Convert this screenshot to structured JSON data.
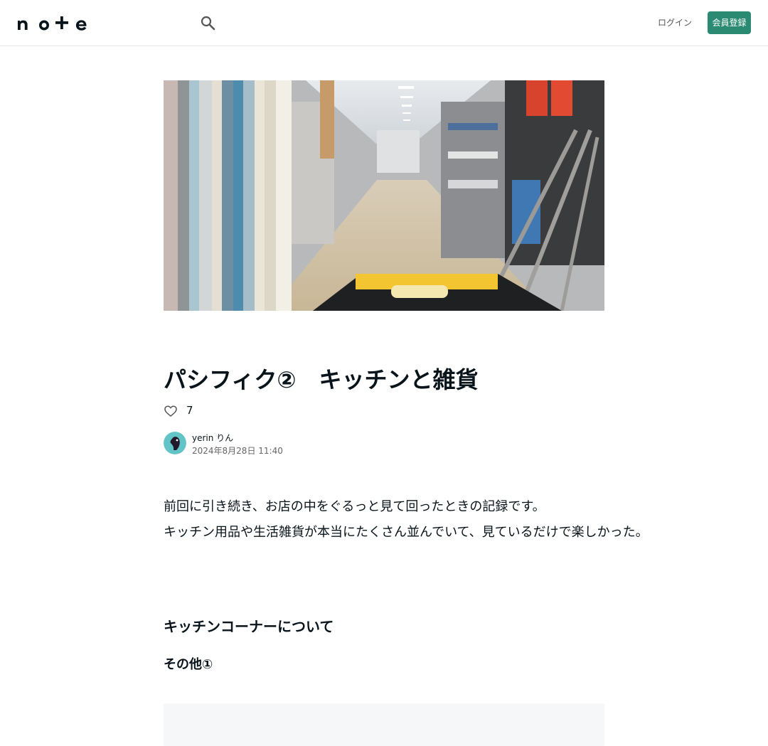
{
  "header": {
    "logo": "note",
    "login_label": "ログイン",
    "signup_label": "会員登録"
  },
  "article": {
    "title": "パシフィク②　キッチンと雑貨",
    "likes": "7",
    "author_name": "yerin りん",
    "date": "2024年8月28日 11:40",
    "paragraphs": [
      "前回に引き続き、お店の中をぐるっと見て回ったときの記録です。",
      "キッチン用品や生活雑貨が本当にたくさん並んでいて、見ているだけで楽しかった。"
    ],
    "section_heading": "キッチンコーナーについて",
    "sub_heading": "その他①"
  },
  "colors": {
    "accent": "#2a8a72",
    "text": "#08131a",
    "border": "#e6e6e6"
  },
  "icons": {
    "search": "search-icon",
    "like": "heart-icon"
  }
}
